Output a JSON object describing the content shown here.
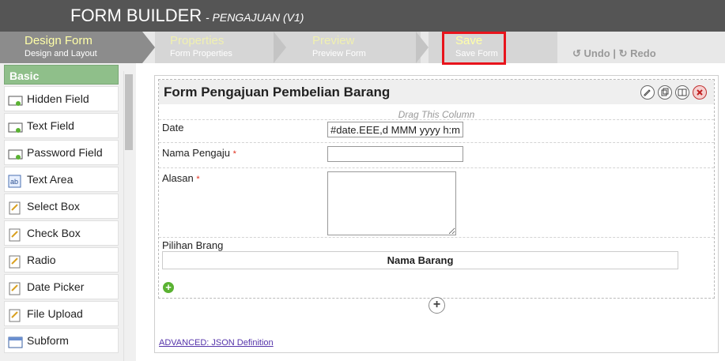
{
  "app": {
    "title": "FORM BUILDER",
    "subtitle": "- PENGAJUAN (V1)"
  },
  "steps": [
    {
      "main": "Design Form",
      "sub": "Design and Layout"
    },
    {
      "main": "Properties",
      "sub": "Form Properties"
    },
    {
      "main": "Preview",
      "sub": "Preview Form"
    },
    {
      "main": "Save",
      "sub": "Save Form"
    }
  ],
  "toolbar": {
    "undo": "Undo",
    "separator": "|",
    "redo": "Redo"
  },
  "palette": {
    "header": "Basic",
    "items": [
      {
        "label": "Hidden Field",
        "icon": "hidden-field-icon"
      },
      {
        "label": "Text Field",
        "icon": "text-field-icon"
      },
      {
        "label": "Password Field",
        "icon": "password-field-icon"
      },
      {
        "label": "Text Area",
        "icon": "text-area-icon"
      },
      {
        "label": "Select Box",
        "icon": "select-box-icon"
      },
      {
        "label": "Check Box",
        "icon": "check-box-icon"
      },
      {
        "label": "Radio",
        "icon": "radio-icon"
      },
      {
        "label": "Date Picker",
        "icon": "date-picker-icon"
      },
      {
        "label": "File Upload",
        "icon": "file-upload-icon"
      },
      {
        "label": "Subform",
        "icon": "subform-icon"
      }
    ]
  },
  "form": {
    "title": "Form Pengajuan Pembelian Barang",
    "drag_hint": "Drag This Column",
    "fields": {
      "date": {
        "label": "Date",
        "value": "#date.EEE,d MMM yyyy h:mm"
      },
      "nama": {
        "label": "Nama Pengaju",
        "required": "*",
        "value": ""
      },
      "alasan": {
        "label": "Alasan",
        "required": "*",
        "value": ""
      },
      "pilihan": {
        "label": "Pilihan Brang",
        "column_header": "Nama Barang"
      }
    }
  },
  "links": {
    "json": "ADVANCED: JSON Definition"
  },
  "colors": {
    "titlebar": "#555555",
    "active_step": "#8c8c8c",
    "palette_header": "#8fbf8a",
    "highlight": "#e8141c"
  }
}
